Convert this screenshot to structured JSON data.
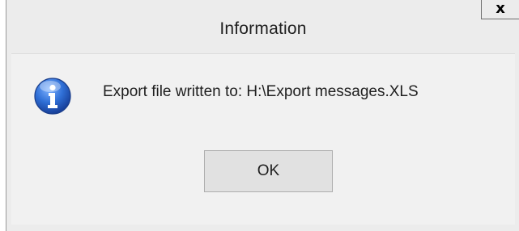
{
  "dialog": {
    "title": "Information",
    "close_label": "x",
    "icon": "information-icon",
    "message": "Export file written to: H:\\Export messages.XLS",
    "ok_label": "OK"
  },
  "colors": {
    "dialog_bg": "#ececec",
    "content_bg": "#f1f1f1",
    "button_bg": "#e1e1e1",
    "icon_blue": "#1f5fbf"
  }
}
